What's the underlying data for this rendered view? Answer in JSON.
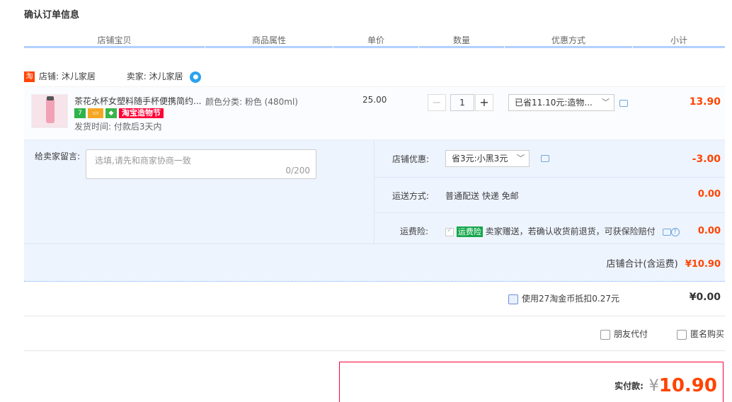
{
  "page": {
    "title": "确认订单信息"
  },
  "table_headers": [
    "店铺宝贝",
    "商品属性",
    "单价",
    "数量",
    "优惠方式",
    "小计"
  ],
  "shop": {
    "tao_icon": "淘",
    "shop_label": "店铺: 沐儿家居",
    "seller_label": "卖家: 沐儿家居",
    "wangwang_icon": "chat-bubble-icon"
  },
  "item": {
    "name": "茶花水杯女塑料随手杯便携简约...",
    "badges": {
      "seven": "7",
      "festival": "淘宝造物节"
    },
    "ship_time": "发货时间: 付款后3天内",
    "attribute": "颜色分类: 粉色 (480ml)",
    "price": "25.00",
    "quantity": "1",
    "minus": "−",
    "plus": "+",
    "discount_select": "已省11.10元:造物...",
    "subtotal": "13.90"
  },
  "order": {
    "memo_label": "给卖家留言:",
    "memo_placeholder": "选填,请先和商家协商一致",
    "memo_count": "0/200",
    "shop_discount_label": "店铺优惠:",
    "shop_discount_select": "省3元:小黑3元",
    "shop_discount_value": "-3.00",
    "shipping_label": "运送方式:",
    "shipping_value": "普通配送 快递 免邮",
    "shipping_price": "0.00",
    "insurance_label": "运费险:",
    "insurance_badge": "运费险",
    "insurance_text": "卖家赠送，若确认收货前退货，可获保险赔付",
    "insurance_price": "0.00"
  },
  "shop_total": {
    "label": "店铺合计(含运费)",
    "value": "¥10.90"
  },
  "coins": {
    "label": "使用27淘金币抵扣0.27元",
    "value": "¥0.00"
  },
  "options": {
    "friend_pay": "朋友代付",
    "anonymous": "匿名购买"
  },
  "payment": {
    "label": "实付款:",
    "currency": "¥",
    "amount": "10.90"
  }
}
